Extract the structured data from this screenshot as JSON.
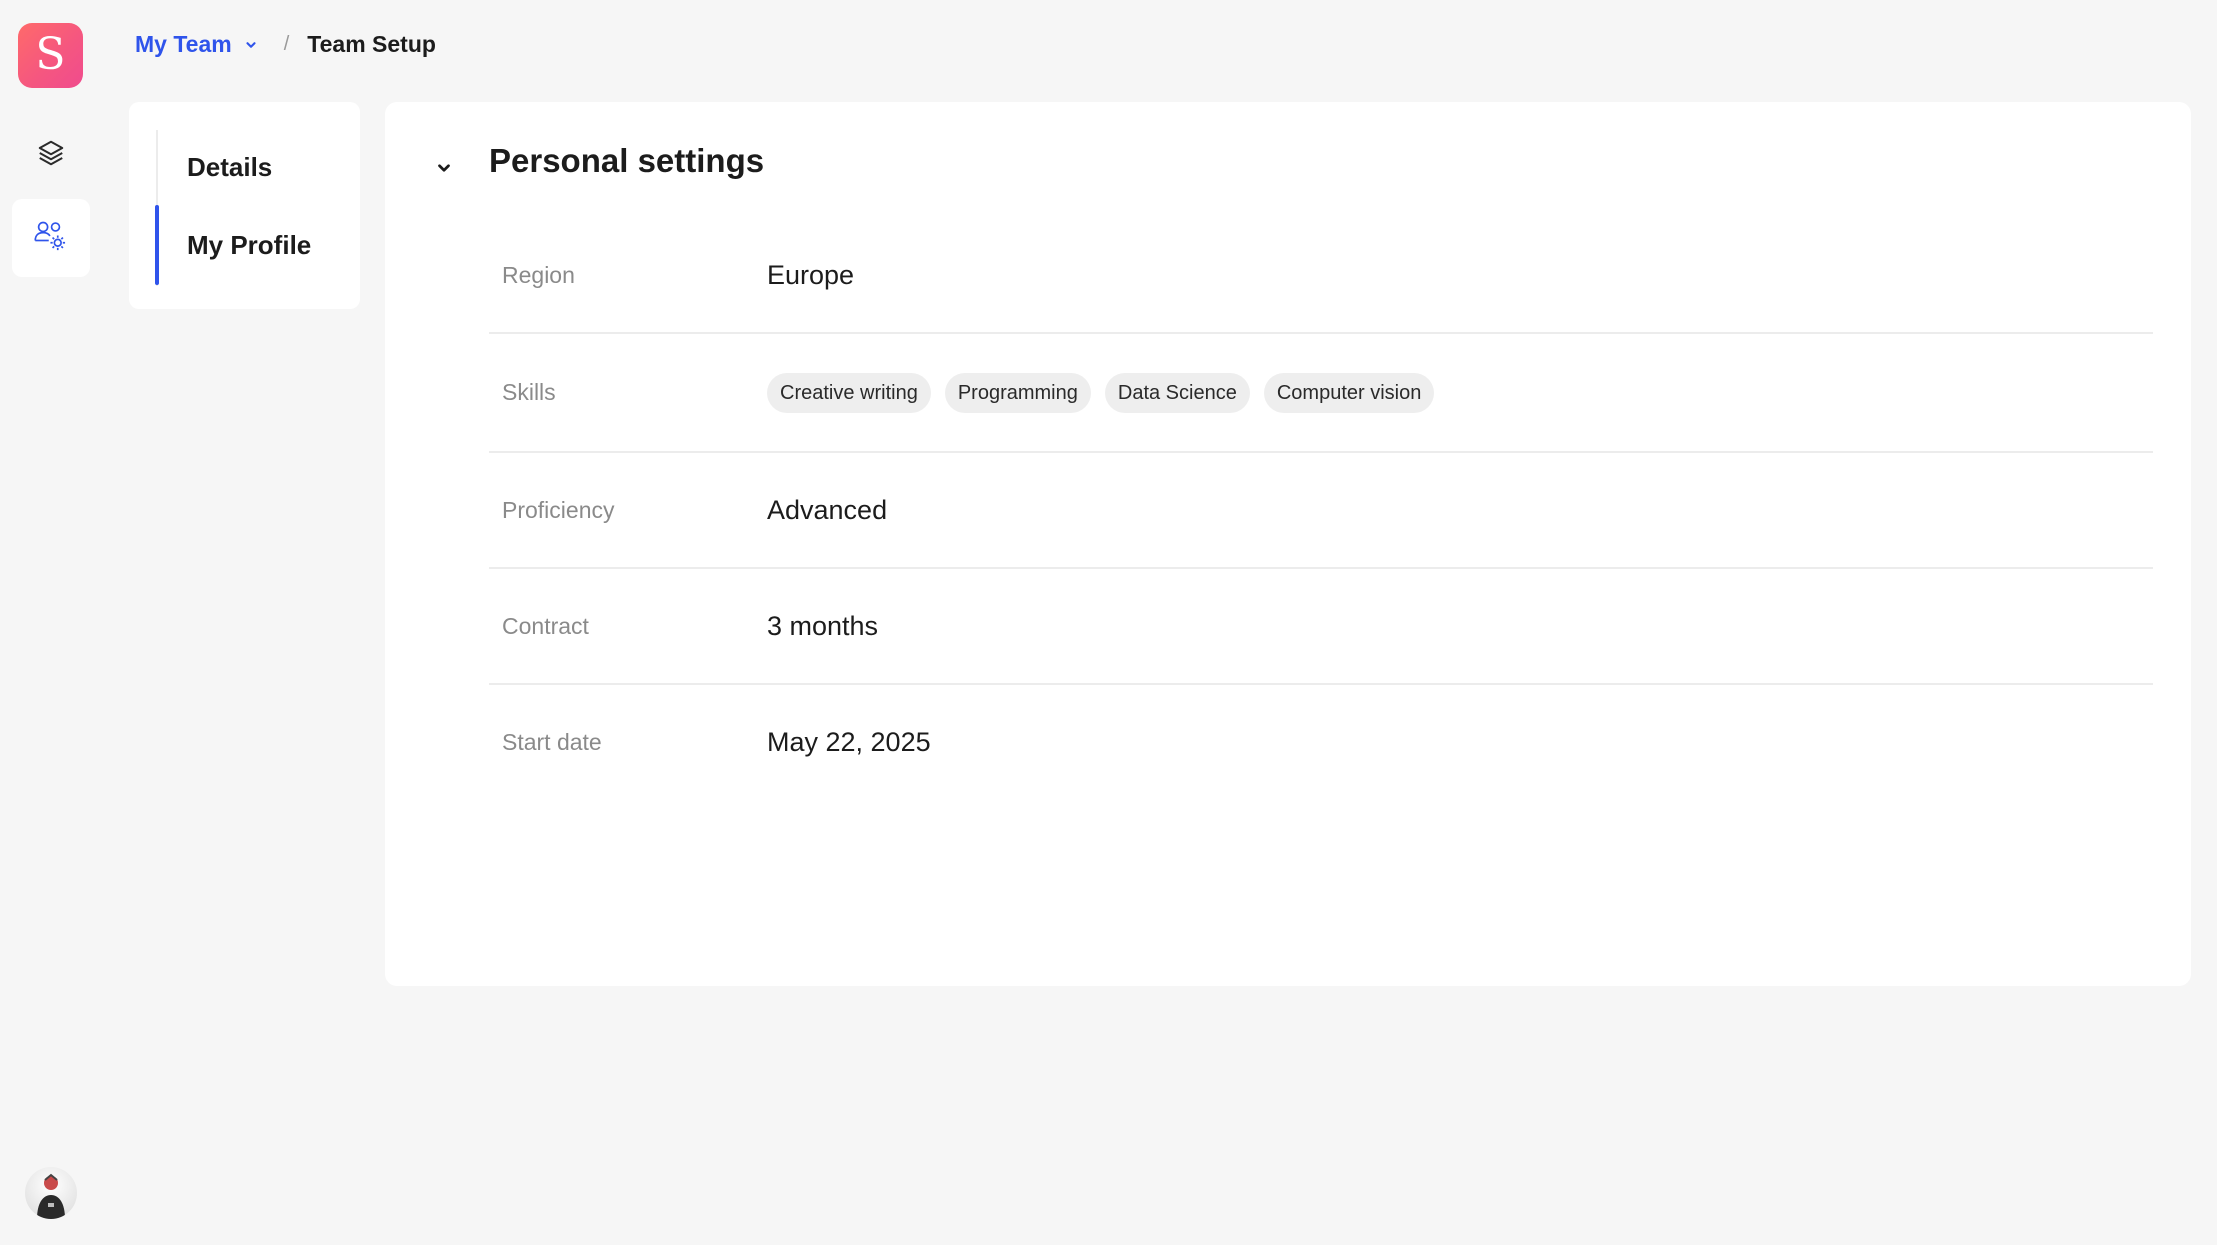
{
  "app": {
    "logo_letter": "S",
    "brand_gradient": [
      "#ff6a6a",
      "#f04b8e"
    ],
    "accent_color": "#2f54eb"
  },
  "rail": {
    "items": [
      {
        "icon": "layers-icon",
        "active": false
      },
      {
        "icon": "team-settings-icon",
        "active": true
      }
    ],
    "avatar_icon": "user-avatar"
  },
  "breadcrumb": {
    "team": "My Team",
    "separator": "/",
    "current": "Team Setup"
  },
  "subnav": {
    "items": [
      {
        "label": "Details",
        "active": false
      },
      {
        "label": "My Profile",
        "active": true
      }
    ]
  },
  "section": {
    "title": "Personal settings",
    "expanded": true
  },
  "fields": {
    "region": {
      "label": "Region",
      "value": "Europe"
    },
    "skills": {
      "label": "Skills",
      "tags": [
        "Creative writing",
        "Programming",
        "Data Science",
        "Computer vision"
      ]
    },
    "proficiency": {
      "label": "Proficiency",
      "value": "Advanced"
    },
    "contract": {
      "label": "Contract",
      "value": "3 months"
    },
    "start_date": {
      "label": "Start date",
      "value": "May 22, 2025"
    }
  }
}
